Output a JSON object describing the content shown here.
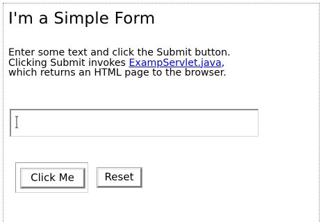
{
  "form": {
    "title": "I'm a Simple Form",
    "description_line1": "Enter some text and click the Submit button.",
    "description_line2_before": "Clicking Submit invokes ",
    "description_link": "ExampServlet.java",
    "description_line2_after": ",",
    "description_line3": "which returns an HTML page to the browser.",
    "text_input_value": "",
    "submit_label": "Click Me",
    "reset_label": "Reset"
  },
  "colors": {
    "link": "#0000ee",
    "frame_border": "#8a8a8a",
    "background": "#ffffff"
  },
  "icons": {
    "text_cursor": "i-beam-cursor-icon"
  }
}
